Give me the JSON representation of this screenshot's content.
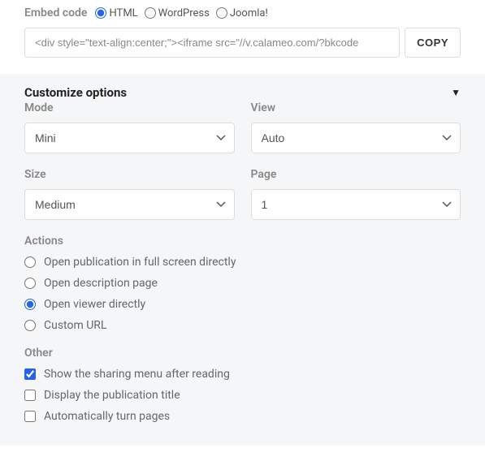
{
  "embed": {
    "label": "Embed code",
    "options": [
      {
        "value": "html",
        "label": "HTML",
        "checked": true
      },
      {
        "value": "wordpress",
        "label": "WordPress",
        "checked": false
      },
      {
        "value": "joomla",
        "label": "Joomla!",
        "checked": false
      }
    ],
    "code_value": "<div style=\"text-align:center;\"><iframe src=\"//v.calameo.com/?bkcode",
    "copy_label": "COPY"
  },
  "customize": {
    "title": "Customize options",
    "fields": {
      "mode": {
        "label": "Mode",
        "value": "Mini"
      },
      "view": {
        "label": "View",
        "value": "Auto"
      },
      "size": {
        "label": "Size",
        "value": "Medium"
      },
      "page": {
        "label": "Page",
        "value": "1"
      }
    },
    "actions": {
      "label": "Actions",
      "items": [
        {
          "label": "Open publication in full screen directly",
          "checked": false
        },
        {
          "label": "Open description page",
          "checked": false
        },
        {
          "label": "Open viewer directly",
          "checked": true
        },
        {
          "label": "Custom URL",
          "checked": false
        }
      ]
    },
    "other": {
      "label": "Other",
      "items": [
        {
          "label": "Show the sharing menu after reading",
          "checked": true
        },
        {
          "label": "Display the publication title",
          "checked": false
        },
        {
          "label": "Automatically turn pages",
          "checked": false
        }
      ]
    }
  }
}
